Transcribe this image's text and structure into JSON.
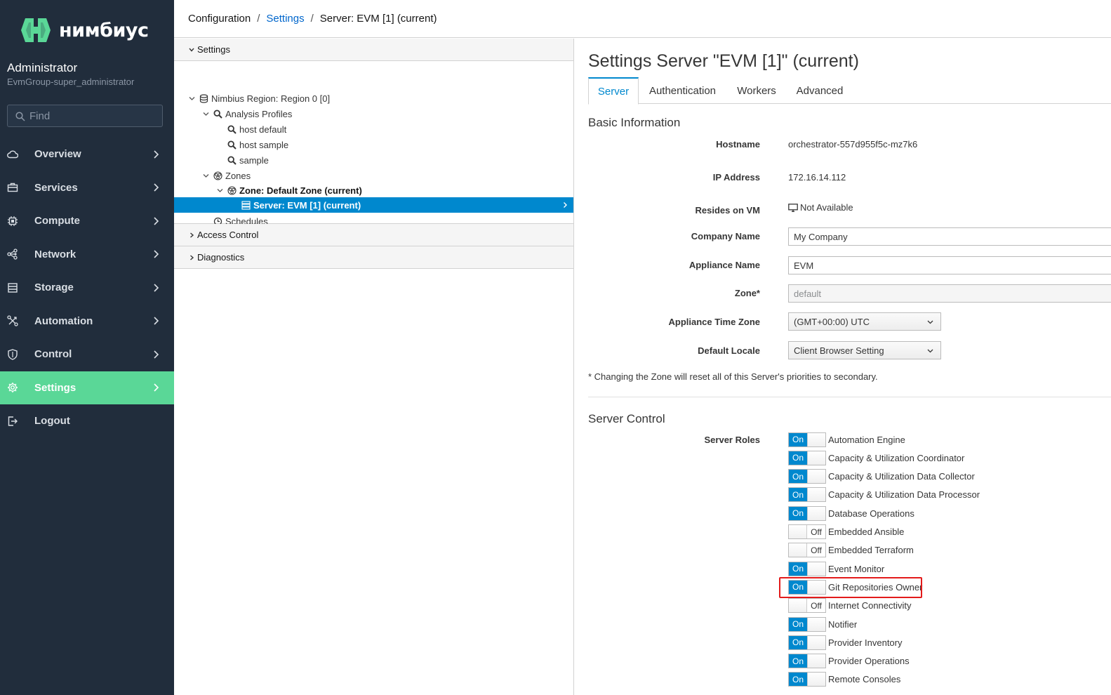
{
  "brand": {
    "name": "нимбиус",
    "color": "#5ad797"
  },
  "user": {
    "name": "Administrator",
    "group": "EvmGroup-super_administrator"
  },
  "search": {
    "placeholder": "Find"
  },
  "nav": [
    {
      "label": "Overview",
      "icon": "cloud-icon"
    },
    {
      "label": "Services",
      "icon": "briefcase-icon"
    },
    {
      "label": "Compute",
      "icon": "cpu-icon"
    },
    {
      "label": "Network",
      "icon": "network-icon"
    },
    {
      "label": "Storage",
      "icon": "database-icon"
    },
    {
      "label": "Automation",
      "icon": "automation-icon"
    },
    {
      "label": "Control",
      "icon": "shield-icon"
    },
    {
      "label": "Settings",
      "icon": "gear-icon",
      "active": true
    },
    {
      "label": "Logout",
      "icon": "logout-icon"
    }
  ],
  "breadcrumb": {
    "item1": "Configuration",
    "item2": "Settings",
    "item3": "Server: EVM [1] (current)",
    "sep": "/"
  },
  "tree": {
    "header": "Settings",
    "nodes": {
      "region": "Nimbius Region: Region 0 [0]",
      "analysis": "Analysis Profiles",
      "host_default": "host default",
      "host_sample": "host sample",
      "sample": "sample",
      "zones": "Zones",
      "zone_default": "Zone: Default Zone (current)",
      "server": "Server: EVM [1] (current)",
      "schedules": "Schedules"
    },
    "access_control": "Access Control",
    "diagnostics": "Diagnostics"
  },
  "page": {
    "title": "Settings Server \"EVM [1]\" (current)",
    "tabs": [
      "Server",
      "Authentication",
      "Workers",
      "Advanced"
    ],
    "active_tab": "Server"
  },
  "basic": {
    "heading": "Basic Information",
    "hostname_label": "Hostname",
    "hostname": "orchestrator-557d955f5c-mz7k6",
    "ip_label": "IP Address",
    "ip": "172.16.14.112",
    "vm_label": "Resides on VM",
    "vm": "Not Available",
    "company_label": "Company Name",
    "company": "My Company",
    "appliance_label": "Appliance Name",
    "appliance": "EVM",
    "zone_label": "Zone*",
    "zone": "default",
    "tz_label": "Appliance Time Zone",
    "tz": "(GMT+00:00) UTC",
    "locale_label": "Default Locale",
    "locale": "Client Browser Setting",
    "note": "* Changing the Zone will reset all of this Server's priorities to secondary."
  },
  "server_control": {
    "heading": "Server Control",
    "roles_label": "Server Roles",
    "on_text": "On",
    "off_text": "Off",
    "roles": [
      {
        "label": "Automation Engine",
        "on": true
      },
      {
        "label": "Capacity & Utilization Coordinator",
        "on": true
      },
      {
        "label": "Capacity & Utilization Data Collector",
        "on": true
      },
      {
        "label": "Capacity & Utilization Data Processor",
        "on": true
      },
      {
        "label": "Database Operations",
        "on": true
      },
      {
        "label": "Embedded Ansible",
        "on": false
      },
      {
        "label": "Embedded Terraform",
        "on": false
      },
      {
        "label": "Event Monitor",
        "on": true
      },
      {
        "label": "Git Repositories Owner",
        "on": true,
        "highlighted": true
      },
      {
        "label": "Internet Connectivity",
        "on": false
      },
      {
        "label": "Notifier",
        "on": true
      },
      {
        "label": "Provider Inventory",
        "on": true
      },
      {
        "label": "Provider Operations",
        "on": true
      },
      {
        "label": "Remote Consoles",
        "on": true
      }
    ]
  },
  "colors": {
    "sidebar": "#212d3c",
    "accent": "#0088ce",
    "active_nav": "#5ad797",
    "highlight": "#e31b1b"
  }
}
